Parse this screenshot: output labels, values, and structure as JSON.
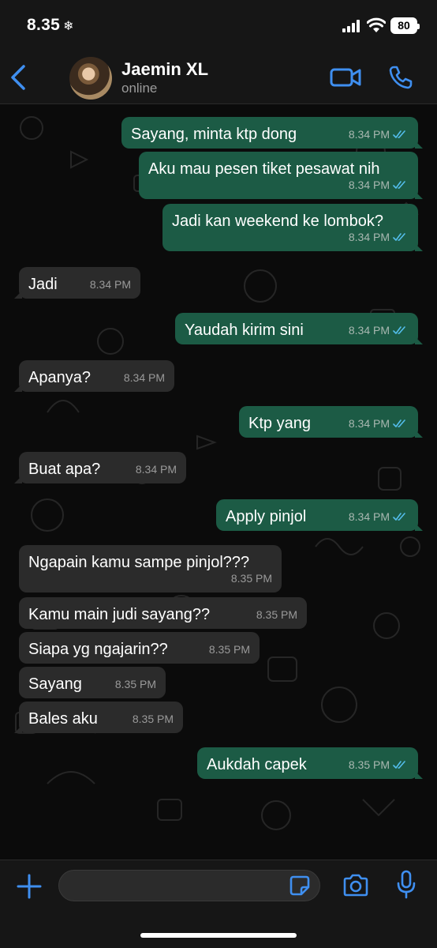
{
  "status_bar": {
    "time": "8.35",
    "weather_glyph": "❄",
    "battery": "80"
  },
  "header": {
    "contact_name": "Jaemin XL",
    "contact_status": "online"
  },
  "messages": [
    {
      "dir": "out",
      "text": "Sayang, minta ktp dong",
      "time": "8.34 PM",
      "read": true
    },
    {
      "dir": "out",
      "text": "Aku mau pesen tiket pesawat nih",
      "time": "8.34 PM",
      "read": true
    },
    {
      "dir": "out",
      "text": "Jadi kan weekend ke lombok?",
      "time": "8.34 PM",
      "read": true
    },
    {
      "dir": "in",
      "text": "Jadi",
      "time": "8.34 PM"
    },
    {
      "dir": "out",
      "text": "Yaudah kirim sini",
      "time": "8.34 PM",
      "read": true
    },
    {
      "dir": "in",
      "text": "Apanya?",
      "time": "8.34 PM"
    },
    {
      "dir": "out",
      "text": "Ktp yang",
      "time": "8.34 PM",
      "read": true
    },
    {
      "dir": "in",
      "text": "Buat apa?",
      "time": "8.34 PM"
    },
    {
      "dir": "out",
      "text": "Apply pinjol",
      "time": "8.34 PM",
      "read": true
    },
    {
      "dir": "in",
      "text": "Ngapain kamu sampe pinjol???",
      "time": "8.35 PM"
    },
    {
      "dir": "in",
      "text": "Kamu main judi sayang??",
      "time": "8.35 PM"
    },
    {
      "dir": "in",
      "text": "Siapa yg ngajarin??",
      "time": "8.35 PM"
    },
    {
      "dir": "in",
      "text": "Sayang",
      "time": "8.35 PM"
    },
    {
      "dir": "in",
      "text": "Bales aku",
      "time": "8.35 PM"
    },
    {
      "dir": "out",
      "text": "Aukdah capek",
      "time": "8.35 PM",
      "read": true
    }
  ],
  "input": {
    "placeholder": "",
    "value": ""
  },
  "colors": {
    "outgoing_bubble": "#1c5b45",
    "incoming_bubble": "#2b2b2b",
    "accent": "#3f8ff0",
    "read_ticks": "#53bdeb"
  },
  "icons": [
    "back-chevron-icon",
    "video-call-icon",
    "phone-call-icon",
    "plus-icon",
    "sticker-icon",
    "camera-icon",
    "microphone-icon",
    "double-check-icon"
  ]
}
